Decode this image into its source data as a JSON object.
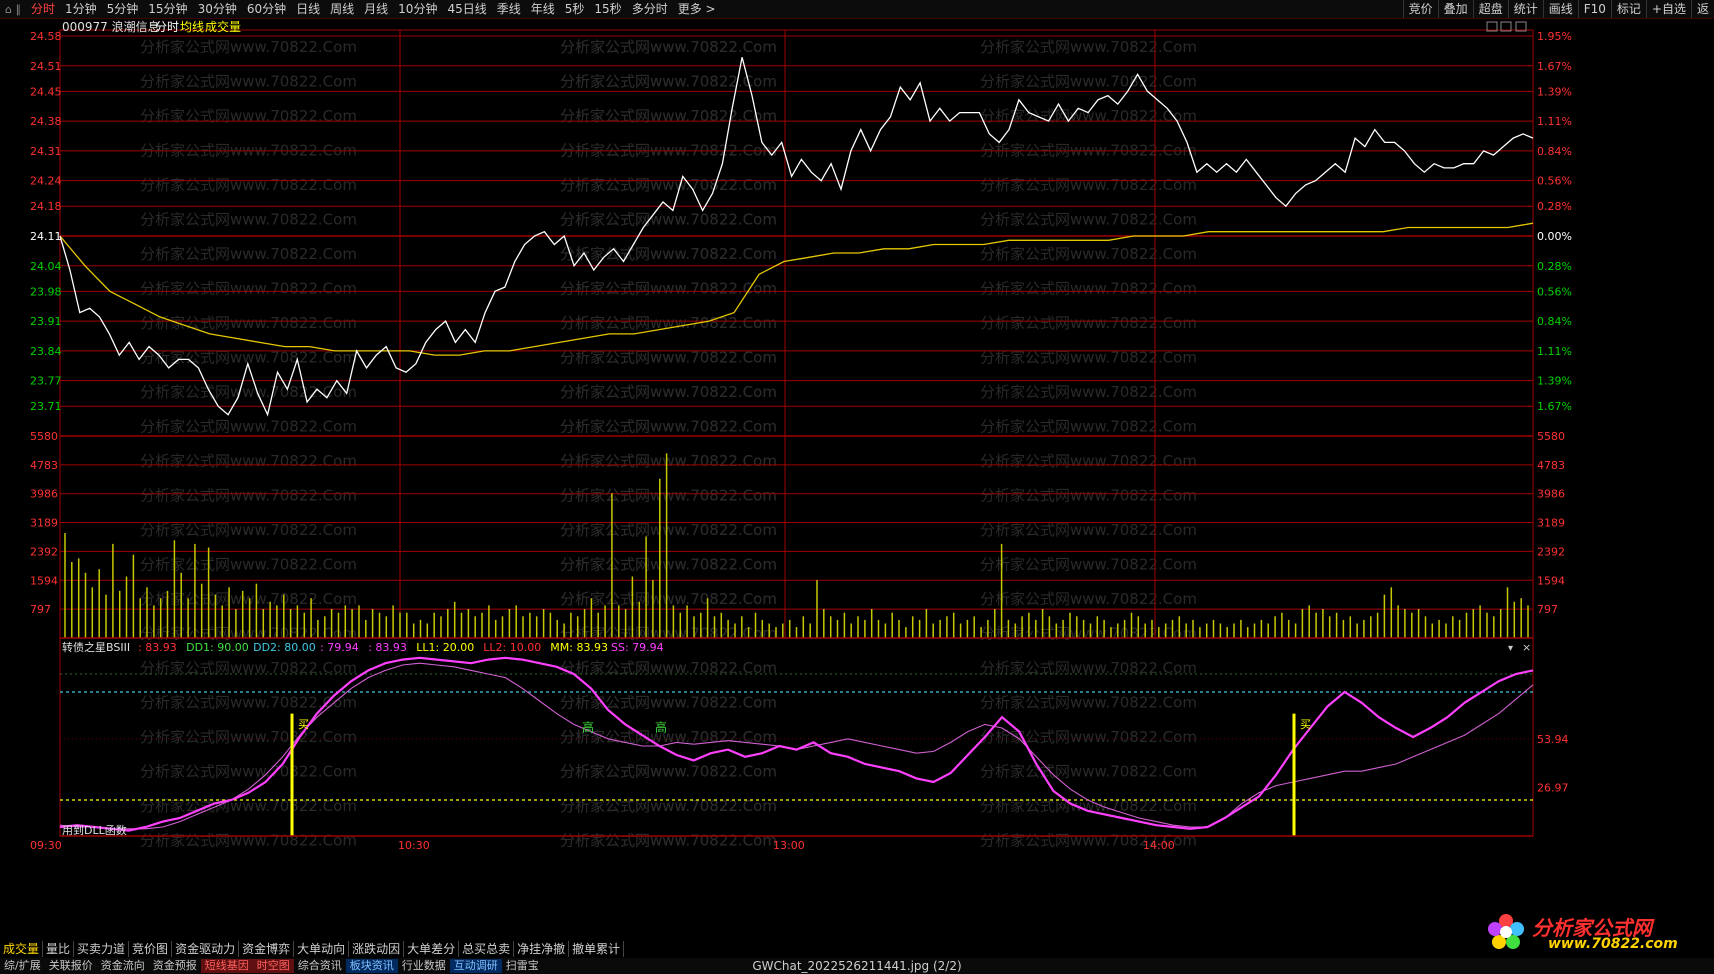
{
  "topbar": {
    "system_label": "⌂ ∥",
    "tabs": [
      "分时",
      "1分钟",
      "5分钟",
      "15分钟",
      "30分钟",
      "60分钟",
      "日线",
      "周线",
      "月线",
      "10分钟",
      "45日线",
      "季线",
      "年线",
      "5秒",
      "15秒",
      "多分时",
      "更多 >"
    ],
    "active_tab": 0,
    "right_buttons": [
      "竞价",
      "叠加",
      "超盘",
      "统计",
      "画线",
      "F10",
      "标记",
      "+自选",
      "返"
    ]
  },
  "header": {
    "code": "000977",
    "name": "浪潮信息",
    "mode": "分时",
    "avg_label": "均线",
    "vol_label": "成交量"
  },
  "colors": {
    "up": "#ff3232",
    "down": "#00d200",
    "price_line": "#ffffff",
    "avg_line": "#e6c800",
    "grid": "#a00000",
    "volume": "#c8c800",
    "pink": "#ff40ff",
    "cyan": "#40c8e0",
    "green": "#40e040",
    "red": "#e02020",
    "yellow": "#ffff00"
  },
  "chart_data": [
    {
      "type": "line",
      "title": "",
      "x_ticks": [
        "09:30",
        "10:30",
        "13:00",
        "14:00"
      ],
      "y_ticks": [
        "24.58",
        "24.51",
        "24.45",
        "24.38",
        "24.31",
        "24.24",
        "24.18",
        "24.11",
        "24.04",
        "23.98",
        "23.91",
        "23.84",
        "23.77",
        "23.71"
      ],
      "y_ticks_right": [
        "1.95%",
        "1.67%",
        "1.39%",
        "1.11%",
        "0.84%",
        "0.56%",
        "0.28%",
        "0.00%",
        "0.28%",
        "0.56%",
        "0.84%",
        "1.11%",
        "1.39%",
        "1.67%"
      ],
      "prev_close": 24.11,
      "ylim": [
        23.64,
        24.58
      ],
      "series": [
        {
          "name": "",
          "role": "price",
          "values": [
            24.11,
            24.03,
            23.93,
            23.94,
            23.92,
            23.88,
            23.83,
            23.86,
            23.82,
            23.85,
            23.83,
            23.8,
            23.82,
            23.82,
            23.8,
            23.75,
            23.71,
            23.69,
            23.73,
            23.81,
            23.74,
            23.69,
            23.79,
            23.75,
            23.82,
            23.72,
            23.75,
            23.73,
            23.77,
            23.74,
            23.84,
            23.8,
            23.83,
            23.85,
            23.8,
            23.79,
            23.81,
            23.86,
            23.89,
            23.91,
            23.86,
            23.89,
            23.86,
            23.93,
            23.98,
            23.99,
            24.05,
            24.09,
            24.11,
            24.12,
            24.09,
            24.11,
            24.04,
            24.07,
            24.03,
            24.06,
            24.08,
            24.05,
            24.09,
            24.13,
            24.16,
            24.19,
            24.17,
            24.25,
            24.22,
            24.17,
            24.21,
            24.28,
            24.41,
            24.53,
            24.44,
            24.33,
            24.3,
            24.33,
            24.25,
            24.29,
            24.26,
            24.24,
            24.28,
            24.22,
            24.31,
            24.36,
            24.31,
            24.36,
            24.39,
            24.46,
            24.43,
            24.47,
            24.38,
            24.41,
            24.38,
            24.4,
            24.4,
            24.4,
            24.35,
            24.33,
            24.36,
            24.43,
            24.4,
            24.39,
            24.38,
            24.42,
            24.38,
            24.41,
            24.4,
            24.43,
            24.44,
            24.42,
            24.45,
            24.49,
            24.45,
            24.43,
            24.41,
            24.38,
            24.33,
            24.26,
            24.28,
            24.26,
            24.28,
            24.26,
            24.29,
            24.26,
            24.23,
            24.2,
            24.18,
            24.21,
            24.23,
            24.24,
            24.26,
            24.28,
            24.26,
            24.34,
            24.32,
            24.36,
            24.33,
            24.33,
            24.31,
            24.28,
            24.26,
            24.28,
            24.27,
            24.27,
            24.28,
            24.28,
            24.31,
            24.3,
            24.32,
            24.34,
            24.35,
            24.34
          ]
        },
        {
          "name": "",
          "role": "avg",
          "values": [
            24.11,
            24.04,
            23.98,
            23.95,
            23.92,
            23.9,
            23.88,
            23.87,
            23.86,
            23.85,
            23.85,
            23.84,
            23.84,
            23.84,
            23.84,
            23.83,
            23.83,
            23.84,
            23.84,
            23.85,
            23.86,
            23.87,
            23.88,
            23.88,
            23.89,
            23.9,
            23.91,
            23.93,
            24.02,
            24.05,
            24.06,
            24.07,
            24.07,
            24.08,
            24.08,
            24.09,
            24.09,
            24.09,
            24.1,
            24.1,
            24.1,
            24.1,
            24.1,
            24.11,
            24.11,
            24.11,
            24.12,
            24.12,
            24.12,
            24.12,
            24.12,
            24.12,
            24.12,
            24.12,
            24.13,
            24.13,
            24.13,
            24.13,
            24.13,
            24.14
          ]
        }
      ]
    },
    {
      "type": "bar",
      "title": "成交量",
      "y_ticks": [
        "5580",
        "4783",
        "3986",
        "3189",
        "2392",
        "1594",
        "797"
      ],
      "ylim": [
        0,
        5580
      ],
      "values": [
        2900,
        2100,
        2200,
        1800,
        1400,
        1900,
        1200,
        2600,
        1300,
        1700,
        2300,
        1100,
        1400,
        900,
        1100,
        1300,
        2700,
        1800,
        1100,
        2600,
        1500,
        2500,
        1200,
        900,
        1400,
        800,
        1300,
        1100,
        1500,
        800,
        1000,
        900,
        1200,
        800,
        900,
        700,
        1100,
        500,
        600,
        800,
        700,
        900,
        800,
        900,
        500,
        800,
        700,
        600,
        900,
        700,
        700,
        400,
        500,
        400,
        700,
        600,
        800,
        1000,
        700,
        800,
        600,
        700,
        900,
        500,
        600,
        800,
        900,
        600,
        700,
        600,
        800,
        700,
        500,
        400,
        700,
        600,
        800,
        1100,
        700,
        900,
        4000,
        900,
        800,
        1700,
        1000,
        2800,
        1600,
        4400,
        5100,
        900,
        700,
        900,
        600,
        700,
        1100,
        600,
        700,
        500,
        400,
        600,
        300,
        700,
        500,
        400,
        300,
        400,
        500,
        300,
        600,
        400,
        1600,
        800,
        600,
        500,
        700,
        400,
        600,
        500,
        800,
        500,
        400,
        700,
        500,
        300,
        600,
        500,
        800,
        400,
        500,
        600,
        700,
        400,
        500,
        600,
        300,
        500,
        800,
        2600,
        500,
        400,
        600,
        700,
        500,
        800,
        600,
        400,
        500,
        700,
        600,
        500,
        400,
        600,
        500,
        300,
        400,
        500,
        700,
        600,
        400,
        500,
        300,
        400,
        500,
        600,
        400,
        500,
        300,
        400,
        500,
        400,
        300,
        400,
        500,
        300,
        400,
        500,
        400,
        600,
        700,
        500,
        400,
        800,
        900,
        700,
        800,
        600,
        700,
        500,
        600,
        400,
        500,
        600,
        700,
        1200,
        1400,
        900,
        800,
        700,
        800,
        600,
        400,
        500,
        400,
        600,
        500,
        700,
        800,
        900,
        700,
        600,
        800,
        1400,
        1000,
        1100,
        900
      ]
    },
    {
      "type": "line",
      "title": "转债之星BSIII",
      "legend": [
        {
          "label": ": 83.93",
          "color": "#ff3232"
        },
        {
          "label": "DD1: 90.00",
          "color": "#40e040"
        },
        {
          "label": "DD2: 80.00",
          "color": "#40c8e0"
        },
        {
          "label": ": 79.94",
          "color": "#ff40ff"
        },
        {
          "label": ": 83.93",
          "color": "#ff40ff"
        },
        {
          "label": "LL1: 20.00",
          "color": "#ffff00"
        },
        {
          "label": "LL2: 10.00",
          "color": "#ff3232"
        },
        {
          "label": "MM: 83.93",
          "color": "#ffff00"
        },
        {
          "label": "SS: 79.94",
          "color": "#ff40ff"
        }
      ],
      "y_ticks": [
        "53.94",
        "26.97"
      ],
      "ylim": [
        0,
        100
      ],
      "annotations": [
        "买",
        "高",
        "高",
        "买"
      ],
      "footnote": "用到DLL函数",
      "series": [
        {
          "name": "",
          "values": [
            5,
            6,
            5,
            4,
            3,
            5,
            8,
            10,
            14,
            18,
            20,
            24,
            30,
            40,
            55,
            68,
            78,
            86,
            92,
            96,
            98,
            99,
            98,
            97,
            96,
            98,
            99,
            98,
            96,
            94,
            90,
            82,
            70,
            62,
            56,
            50,
            45,
            42,
            46,
            48,
            44,
            46,
            50,
            48,
            52,
            46,
            44,
            40,
            38,
            36,
            32,
            30,
            35,
            45,
            55,
            66,
            58,
            40,
            25,
            18,
            14,
            12,
            10,
            8,
            6,
            5,
            4,
            5,
            10,
            16,
            22,
            34,
            48,
            60,
            72,
            80,
            74,
            66,
            60,
            55,
            60,
            66,
            74,
            80,
            86,
            90,
            92
          ]
        },
        {
          "name": "",
          "values": [
            6,
            5,
            5,
            4,
            4,
            4,
            5,
            8,
            12,
            16,
            20,
            26,
            34,
            44,
            56,
            66,
            74,
            82,
            88,
            92,
            95,
            96,
            95,
            94,
            92,
            90,
            88,
            82,
            75,
            68,
            62,
            58,
            54,
            52,
            50,
            50,
            52,
            51,
            52,
            53,
            52,
            51,
            50,
            48,
            50,
            52,
            54,
            52,
            50,
            48,
            46,
            47,
            52,
            58,
            62,
            60,
            54,
            44,
            34,
            26,
            20,
            16,
            13,
            10,
            8,
            6,
            5,
            5,
            10,
            18,
            24,
            28,
            30,
            32,
            34,
            36,
            36,
            38,
            40,
            44,
            48,
            52,
            56,
            62,
            68,
            76,
            84
          ]
        }
      ]
    }
  ],
  "bottom_tabs": [
    "成交量",
    "量比",
    "买卖力道",
    "竞价图",
    "资金驱动力",
    "资金博弈",
    "大单动向",
    "涨跌动因",
    "大单差分",
    "总买总卖",
    "净挂净撤",
    "撤单累计"
  ],
  "bottom_bar2": [
    "综/扩展",
    "关联报价",
    "资金流向",
    "资金预报",
    "短线基因",
    "时空图",
    "综合资讯",
    "板块资讯",
    "行业数据",
    "互动调研",
    "扫雷宝"
  ],
  "caption": "GWChat_2022526211441.jpg (2/2)",
  "logo": {
    "brand": "分析家公式网",
    "url": "www.70822.com"
  },
  "watermark": "分析家公式网www.70822.Com"
}
